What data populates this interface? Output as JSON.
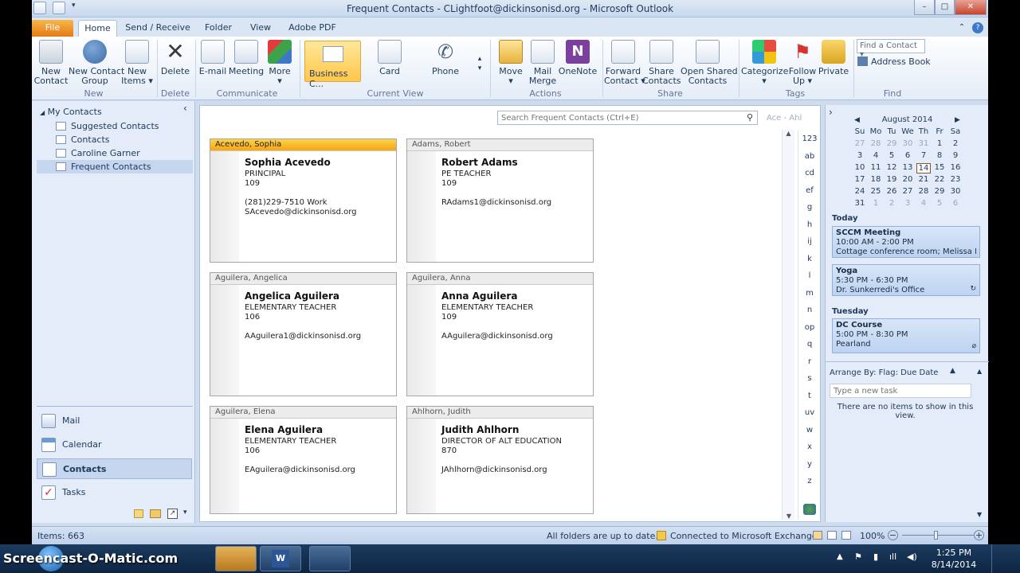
{
  "window": {
    "title": "Frequent Contacts - CLightfoot@dickinsonisd.org - Microsoft Outlook",
    "min": "–",
    "max": "□",
    "close": "✕"
  },
  "tabs": [
    {
      "label": "File"
    },
    {
      "label": "Home"
    },
    {
      "label": "Send / Receive"
    },
    {
      "label": "Folder"
    },
    {
      "label": "View"
    },
    {
      "label": "Adobe PDF"
    }
  ],
  "ribbon": {
    "new_contact": "New\nContact",
    "new_group": "New Contact\nGroup",
    "new_items": "New\nItems ▾",
    "group_new": "New",
    "delete": "Delete",
    "group_delete": "Delete",
    "email": "E-mail",
    "meeting": "Meeting",
    "more": "More\n▾",
    "group_communicate": "Communicate",
    "business_card": "Business C...",
    "card": "Card",
    "phone": "Phone",
    "group_current_view": "Current View",
    "move": "Move\n▾",
    "mail_merge": "Mail\nMerge",
    "onenote": "OneNote",
    "group_actions": "Actions",
    "forward_contact": "Forward\nContact ▾",
    "share_contacts": "Share\nContacts",
    "open_shared": "Open Shared\nContacts",
    "group_share": "Share",
    "categorize": "Categorize\n▾",
    "follow_up": "Follow\nUp ▾",
    "private": "Private",
    "group_tags": "Tags",
    "find_contact": "Find a Contact ▾",
    "address_book": "Address Book",
    "group_find": "Find"
  },
  "nav": {
    "header": "My Contacts",
    "folders": [
      "Suggested Contacts",
      "Contacts",
      "Caroline Garner",
      "Frequent Contacts"
    ],
    "modules": [
      "Mail",
      "Calendar",
      "Contacts",
      "Tasks"
    ]
  },
  "search": {
    "placeholder": "Search Frequent Contacts (Ctrl+E)",
    "range": "Ace - Ahl"
  },
  "cards": [
    {
      "header": "Acevedo, Sophia",
      "name": "Sophia Acevedo",
      "title": "PRINCIPAL",
      "room": "109",
      "phone": "(281)229-7510  Work",
      "email": "SAcevedo@dickinsonisd.org"
    },
    {
      "header": "Adams, Robert",
      "name": "Robert Adams",
      "title": "PE TEACHER",
      "room": "109",
      "phone": "",
      "email": "RAdams1@dickinsonisd.org"
    },
    {
      "header": "Aguilera, Angelica",
      "name": "Angelica Aguilera",
      "title": "ELEMENTARY TEACHER",
      "room": "106",
      "phone": "",
      "email": "AAguilera1@dickinsonisd.org"
    },
    {
      "header": "Aguilera, Anna",
      "name": "Anna Aguilera",
      "title": "ELEMENTARY TEACHER",
      "room": "109",
      "phone": "",
      "email": "AAguilera@dickinsonisd.org"
    },
    {
      "header": "Aguilera, Elena",
      "name": "Elena Aguilera",
      "title": "ELEMENTARY TEACHER",
      "room": "106",
      "phone": "",
      "email": "EAguilera@dickinsonisd.org"
    },
    {
      "header": "Ahlhorn, Judith",
      "name": "Judith Ahlhorn",
      "title": "DIRECTOR OF ALT EDUCATION",
      "room": "870",
      "phone": "",
      "email": "JAhlhorn@dickinsonisd.org"
    }
  ],
  "alpha": [
    "123",
    "ab",
    "cd",
    "ef",
    "g",
    "h",
    "ij",
    "k",
    "l",
    "m",
    "n",
    "op",
    "q",
    "r",
    "s",
    "t",
    "uv",
    "w",
    "x",
    "y",
    "z"
  ],
  "calendar": {
    "month": "August 2014",
    "days": [
      "Su",
      "Mo",
      "Tu",
      "We",
      "Th",
      "Fr",
      "Sa"
    ],
    "weeks": [
      [
        "27",
        "28",
        "29",
        "30",
        "31",
        "1",
        "2"
      ],
      [
        "3",
        "4",
        "5",
        "6",
        "7",
        "8",
        "9"
      ],
      [
        "10",
        "11",
        "12",
        "13",
        "14",
        "15",
        "16"
      ],
      [
        "17",
        "18",
        "19",
        "20",
        "21",
        "22",
        "23"
      ],
      [
        "24",
        "25",
        "26",
        "27",
        "28",
        "29",
        "30"
      ],
      [
        "31",
        "1",
        "2",
        "3",
        "4",
        "5",
        "6"
      ]
    ]
  },
  "today_label": "Today",
  "appointments": [
    {
      "title": "SCCM Meeting",
      "time": "10:00 AM - 2:00 PM",
      "place": "Cottage conference room; Melissa K"
    },
    {
      "title": "Yoga",
      "time": "5:30 PM - 6:30 PM",
      "place": "Dr. Sunkerredi's Office"
    },
    {
      "title": "DC Course",
      "time": "5:00 PM - 8:30 PM",
      "place": "Pearland"
    }
  ],
  "tuesday_label": "Tuesday",
  "tasks": {
    "arrange": "Arrange By: Flag: Due Date",
    "placeholder": "Type a new task",
    "empty": "There are no items to show in this view."
  },
  "status": {
    "items": "Items: 663",
    "folders": "All folders are up to date.",
    "exchange": "Connected to Microsoft Exchange",
    "zoom": "100%"
  },
  "taskbar": {
    "watermark": "Screencast-O-Matic.com",
    "time": "1:25 PM",
    "date": "8/14/2014"
  }
}
